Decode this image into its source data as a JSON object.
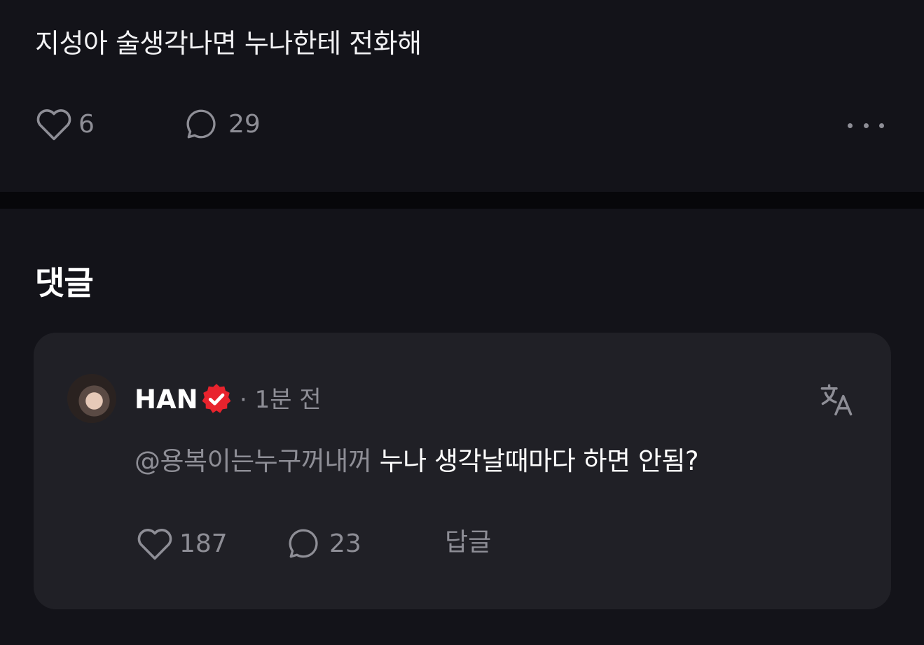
{
  "post": {
    "text": "지성아 술생각나면 누나한테 전화해",
    "likes": "6",
    "comments": "29"
  },
  "comments_section": {
    "title": "댓글",
    "items": [
      {
        "author": "HAN",
        "time": "· 1분 전",
        "mention": "@용복이는누구꺼내꺼",
        "text": "누나 생각날때마다 하면 안됨?",
        "likes": "187",
        "replies": "23",
        "reply_label": "답글"
      }
    ]
  },
  "colors": {
    "background": "#131319",
    "divider": "#07070a",
    "card": "#202026",
    "muted": "#8e8e96",
    "verified_badge": "#e8232d"
  },
  "icons": [
    "heart-icon",
    "comment-bubble-icon",
    "more-horizontal-icon",
    "verified-badge-icon",
    "translate-icon"
  ]
}
